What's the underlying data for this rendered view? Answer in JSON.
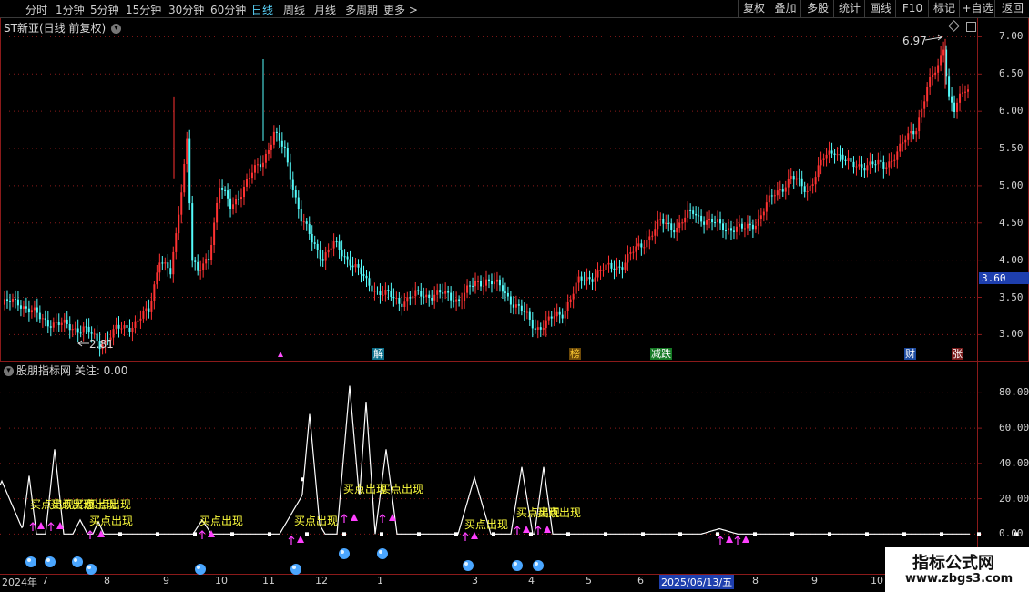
{
  "toolbar": {
    "left": [
      "分时",
      "1分钟",
      "5分钟",
      "15分钟",
      "30分钟",
      "60分钟",
      "日线",
      "周线",
      "月线",
      "多周期",
      "更多 >"
    ],
    "active_index": 6,
    "right": [
      "复权",
      "叠加",
      "多股",
      "统计",
      "画线",
      "F10",
      "标记",
      "+自选",
      "返回"
    ]
  },
  "main_panel": {
    "title": "ST新亚(日线 前复权)",
    "high_label": "6.97",
    "low_label": "2.81",
    "current_price": "3.60",
    "y_ticks": [
      "7.00",
      "6.50",
      "6.00",
      "5.50",
      "5.00",
      "4.50",
      "4.00",
      "3.50",
      "3.00"
    ],
    "events": [
      "解",
      "榜",
      "减跌",
      "财",
      "张"
    ],
    "colors": {
      "up": "#ff3232",
      "down": "#54fcfc",
      "grid": "#8b1a1a",
      "price_tag": "#1e3fae"
    }
  },
  "indicator_panel": {
    "title": "股朋指标网 关注: 0.00",
    "y_ticks": [
      "80.00",
      "60.00",
      "40.00",
      "20.00",
      "0.00"
    ],
    "signal_label": "买点出现",
    "labels": [
      "买点出现",
      "买点出现",
      "买点出现",
      "买点出现",
      "买点出现",
      "买点出现",
      "买点出现",
      "买点出现",
      "买点出现",
      "买点出现",
      "买点出现",
      "买点出现"
    ]
  },
  "date_axis": {
    "labels": [
      "2024年",
      "7",
      "8",
      "9",
      "10",
      "11",
      "12",
      "1",
      "3",
      "4",
      "5",
      "6",
      "2025/06/13/五",
      "8",
      "9",
      "10"
    ]
  },
  "watermark": {
    "title": "指标公式网",
    "url": "www.zbgs3.com"
  },
  "chart_data": {
    "type": "candlestick",
    "price_range": [
      2.65,
      7.25
    ],
    "high": 6.97,
    "low": 2.81,
    "last": 3.6,
    "indicator_range": [
      -5,
      90
    ]
  }
}
